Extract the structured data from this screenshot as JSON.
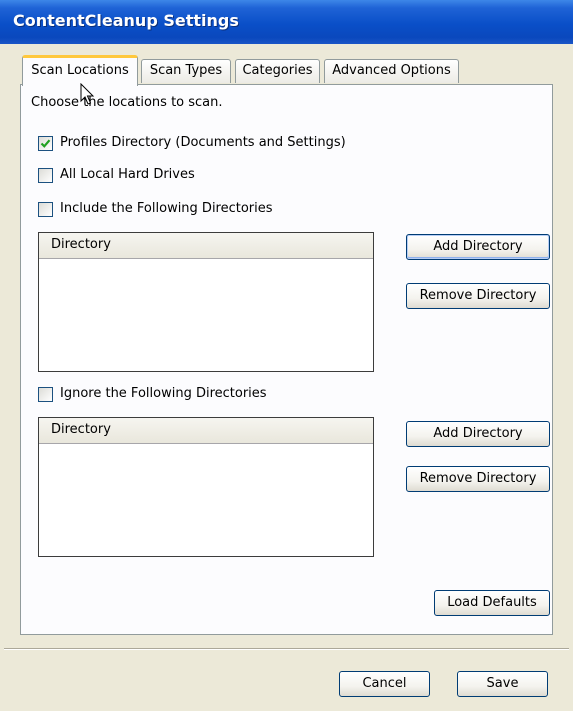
{
  "window": {
    "title": "ContentCleanup Settings"
  },
  "tabs": [
    {
      "label": "Scan Locations",
      "active": true
    },
    {
      "label": "Scan Types",
      "active": false
    },
    {
      "label": "Categories",
      "active": false
    },
    {
      "label": "Advanced Options",
      "active": false
    }
  ],
  "scan_locations": {
    "instruction": "Choose the locations to scan.",
    "profiles": {
      "label": "Profiles Directory (Documents and Settings)",
      "checked": true
    },
    "all_drives": {
      "label": "All Local Hard Drives",
      "checked": false
    },
    "include": {
      "label": "Include the Following Directories",
      "checked": false,
      "column_header": "Directory",
      "rows": [],
      "add_label": "Add Directory",
      "remove_label": "Remove Directory"
    },
    "ignore": {
      "label": "Ignore the Following Directories",
      "checked": false,
      "column_header": "Directory",
      "rows": [],
      "add_label": "Add Directory",
      "remove_label": "Remove Directory"
    },
    "load_defaults_label": "Load Defaults"
  },
  "footer": {
    "cancel_label": "Cancel",
    "save_label": "Save"
  },
  "colors": {
    "title_bar": "#0a4fc8",
    "active_tab_accent": "#ffc83c",
    "checkmark": "#21a121",
    "dialog_bg": "#ece9d8"
  }
}
